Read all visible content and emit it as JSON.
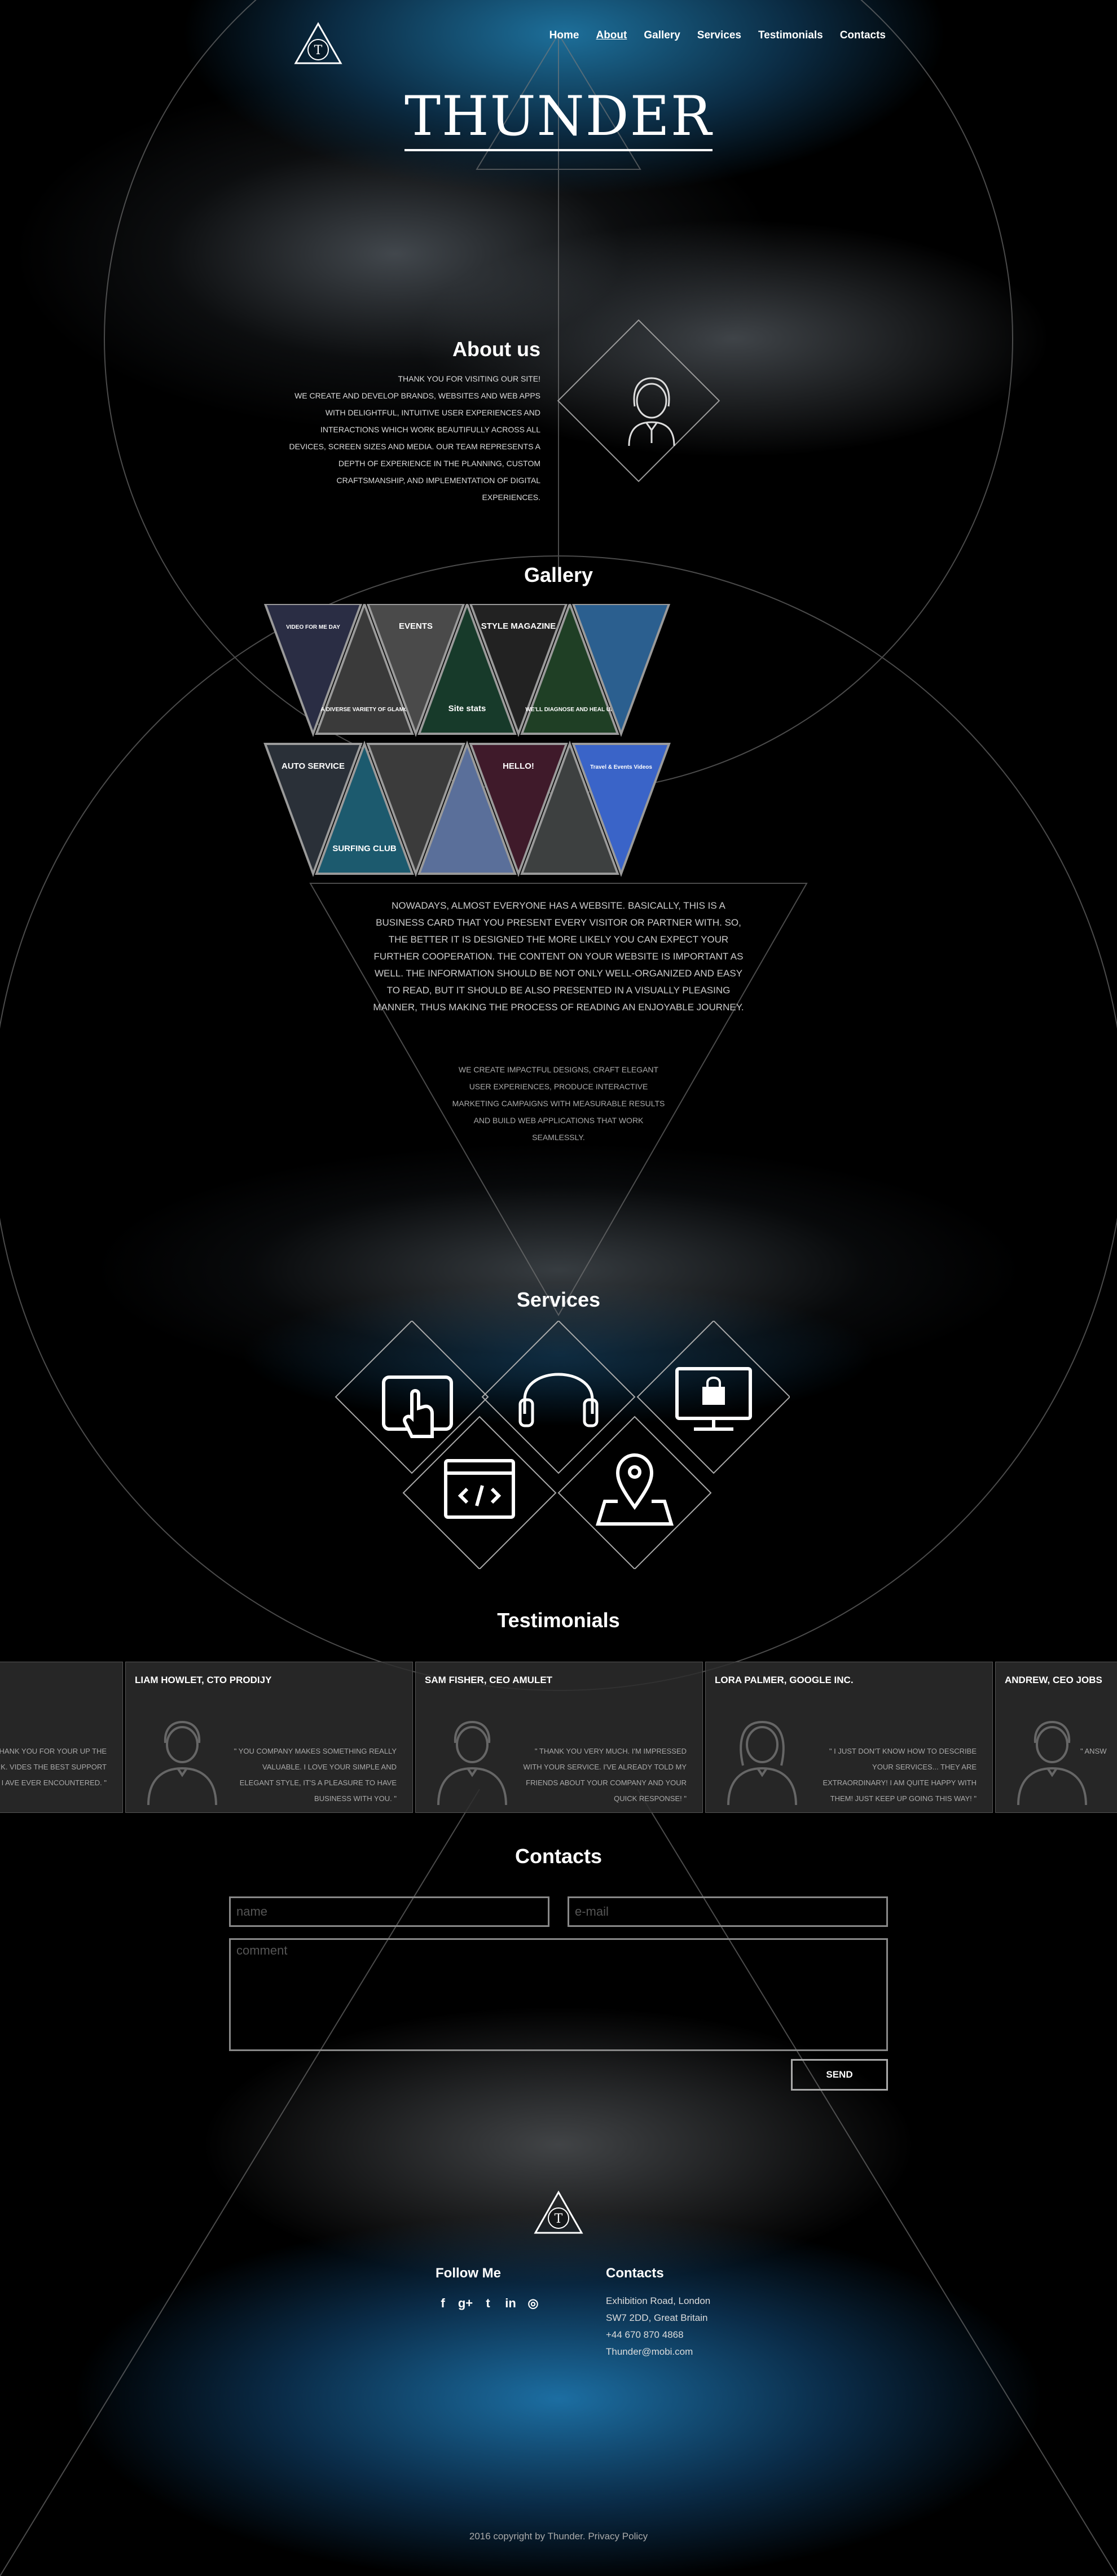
{
  "brand": {
    "name": "THUNDER",
    "logo_letter": "T"
  },
  "nav": {
    "items": [
      {
        "label": "Home"
      },
      {
        "label": "About"
      },
      {
        "label": "Gallery"
      },
      {
        "label": "Services"
      },
      {
        "label": "Testimonials"
      },
      {
        "label": "Contacts"
      }
    ],
    "active": "About"
  },
  "about": {
    "title": "About us",
    "lines": [
      "THANK YOU FOR VISITING OUR SITE!",
      "WE CREATE AND DEVELOP BRANDS, WEBSITES AND WEB APPS",
      "WITH DELIGHTFUL, INTUITIVE USER EXPERIENCES AND",
      "INTERACTIONS WHICH WORK BEAUTIFULLY ACROSS ALL",
      "DEVICES, SCREEN SIZES AND MEDIA. OUR TEAM REPRESENTS A",
      "DEPTH OF EXPERIENCE IN THE PLANNING, CUSTOM",
      "CRAFTSMANSHIP, AND IMPLEMENTATION OF DIGITAL",
      "EXPERIENCES."
    ]
  },
  "gallery": {
    "title": "Gallery",
    "thumbnails": [
      {
        "caption": "VIDEO FOR ME DAY",
        "color": "#2a2d44"
      },
      {
        "caption": "A DIVERSE VARIETY OF GLAMOROUS HIGH QUALITY LINGERIE",
        "color": "#3a3a3a"
      },
      {
        "caption": "EVENTS",
        "color": "#4a4a4a"
      },
      {
        "caption": "Site stats",
        "color": "#173a2a"
      },
      {
        "caption": "STYLE MAGAZINE",
        "color": "#222222"
      },
      {
        "caption": "WE'LL DIAGNOSE AND HEAL UP YOU",
        "color": "#1f3f25"
      },
      {
        "caption": "",
        "color": "#2b5f8f"
      },
      {
        "caption": "AUTO SERVICE",
        "color": "#2a3038"
      },
      {
        "caption": "SURFING CLUB",
        "color": "#1c5a6e"
      },
      {
        "caption": "",
        "color": "#3b3b3b"
      },
      {
        "caption": "",
        "color": "#5a6f9a"
      },
      {
        "caption": "HELLO!",
        "color": "#3f1a2a"
      },
      {
        "caption": "",
        "color": "#3d4040"
      },
      {
        "caption": "Travel & Events Videos",
        "color": "#3a64c8"
      }
    ],
    "text": "NOWADAYS, ALMOST EVERYONE HAS A WEBSITE. BASICALLY, THIS IS A BUSINESS CARD THAT YOU PRESENT EVERY VISITOR OR PARTNER WITH. SO, THE BETTER IT IS DESIGNED THE MORE LIKELY YOU CAN EXPECT YOUR FURTHER COOPERATION. THE CONTENT ON YOUR WEBSITE IS IMPORTANT AS WELL. THE INFORMATION SHOULD BE NOT ONLY WELL-ORGANIZED AND EASY TO READ, BUT IT SHOULD BE ALSO PRESENTED IN A VISUALLY PLEASING MANNER, THUS MAKING THE PROCESS OF READING AN ENJOYABLE JOURNEY.",
    "text2": "WE CREATE IMPACTFUL DESIGNS, CRAFT ELEGANT USER EXPERIENCES, PRODUCE INTERACTIVE MARKETING CAMPAIGNS WITH MEASURABLE RESULTS AND BUILD WEB APPLICATIONS THAT WORK SEAMLESSLY."
  },
  "services": {
    "title": "Services",
    "items": [
      {
        "icon": "tablet-touch-icon"
      },
      {
        "icon": "headphones-icon"
      },
      {
        "icon": "monitor-lock-icon"
      },
      {
        "icon": "code-window-icon"
      },
      {
        "icon": "map-pin-icon"
      }
    ]
  },
  "testimonials": {
    "title": "Testimonials",
    "cards": [
      {
        "name": "",
        "text": "T TO THANK YOU FOR YOUR UP THE EXCELLENT WORK. VIDES THE BEST SUPPORT I AVE EVER ENCOUNTERED. \"",
        "avatar": "male-avatar-icon"
      },
      {
        "name": "LIAM HOWLET, CTO PRODIJY",
        "text": "\" YOU COMPANY MAKES SOMETHING REALLY VALUABLE. I LOVE YOUR SIMPLE AND ELEGANT STYLE, IT'S A PLEASURE TO HAVE BUSINESS WITH YOU. \"",
        "avatar": "male-avatar-icon"
      },
      {
        "name": "SAM FISHER, CEO AMULET",
        "text": "\" THANK YOU VERY MUCH. I'M IMPRESSED WITH YOUR SERVICE. I'VE ALREADY TOLD MY FRIENDS ABOUT YOUR COMPANY AND YOUR QUICK RESPONSE! \"",
        "avatar": "male-avatar-icon"
      },
      {
        "name": "LORA PALMER, GOOGLE INC.",
        "text": "\" I JUST DON'T KNOW HOW TO DESCRIBE YOUR SERVICES... THEY ARE EXTRAORDINARY! I AM QUITE HAPPY WITH THEM! JUST KEEP UP GOING THIS WAY! \"",
        "avatar": "female-avatar-icon"
      },
      {
        "name": "ANDREW, CEO JOBS",
        "text": "\" ANSW",
        "avatar": "male-avatar-icon"
      }
    ]
  },
  "contacts_form": {
    "title": "Contacts",
    "name_placeholder": "name",
    "email_placeholder": "e-mail",
    "comment_placeholder": "comment",
    "send_label": "SEND"
  },
  "footer": {
    "follow_title": "Follow Me",
    "socials": [
      {
        "icon": "facebook-icon",
        "glyph": "f"
      },
      {
        "icon": "google-plus-icon",
        "glyph": "g+"
      },
      {
        "icon": "twitter-icon",
        "glyph": "t"
      },
      {
        "icon": "linkedin-icon",
        "glyph": "in"
      },
      {
        "icon": "instagram-icon",
        "glyph": "◎"
      }
    ],
    "contacts_title": "Contacts",
    "address1": "Exhibition Road, London",
    "address2": "SW7 2DD, Great Britain",
    "phone": "+44 670 870 4868",
    "email": "Thunder@mobi.com",
    "copyright": "2016 copyright by Thunder. Privacy Policy"
  },
  "colors": {
    "accent_blue": "#1c6ea2",
    "line": "#8a8a8a",
    "card_bg": "#2d2d2d"
  }
}
